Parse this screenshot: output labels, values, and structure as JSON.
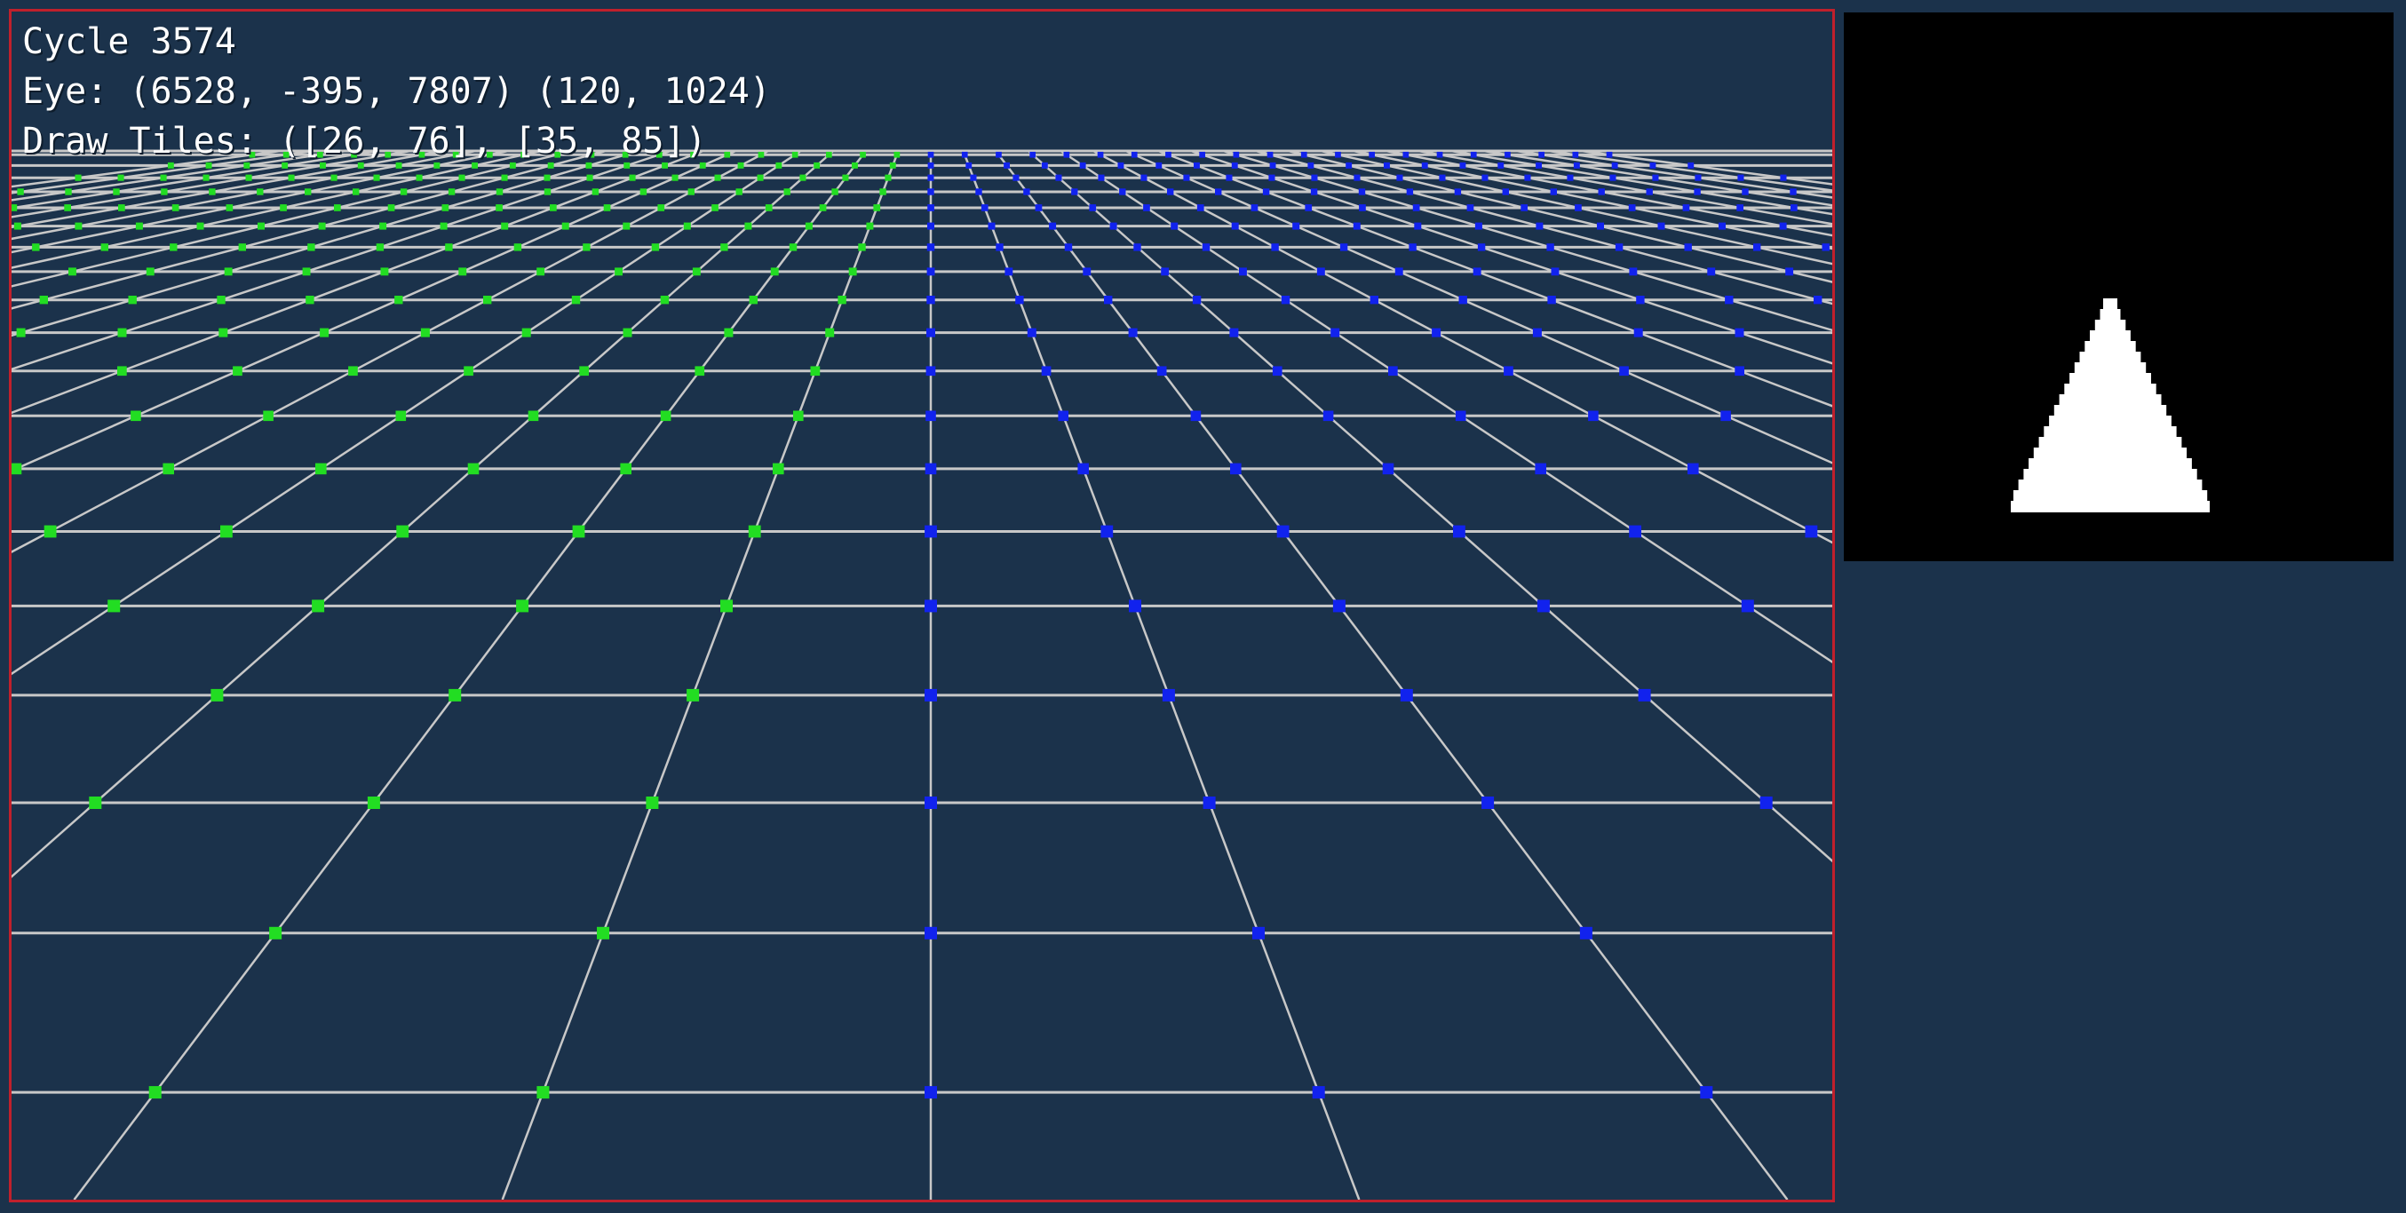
{
  "hud": {
    "cycle": "Cycle 3574",
    "eye": "Eye: (6528, -395, 7807) (120, 1024)",
    "draw_tiles": "Draw Tiles: ([26, 76], [35, 85])"
  },
  "colors": {
    "background": "#1b324b",
    "viewport_border": "#c0202c",
    "grid_line": "#c8c8c8",
    "left_marker": "#22dd22",
    "right_marker": "#1122ee",
    "center_marker": "#1122ee",
    "minimap_bg": "#000000",
    "minimap_shape": "#ffffff"
  },
  "icons": {
    "minimap_shape": "triangle-stepped-shape"
  }
}
